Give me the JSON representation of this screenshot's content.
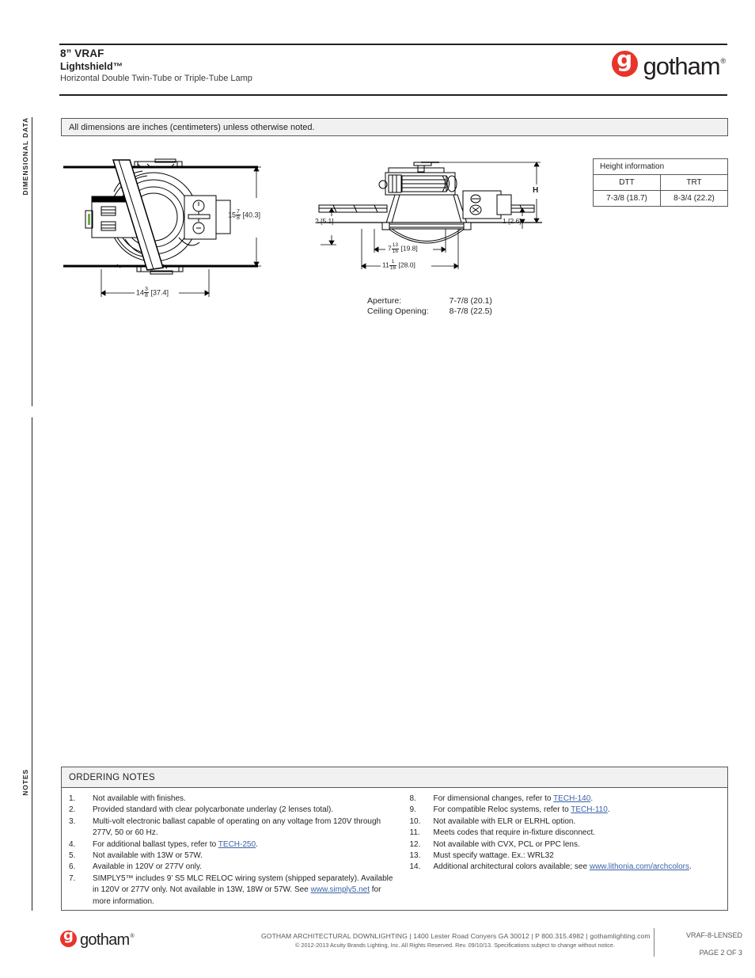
{
  "header": {
    "title": "8” VRAF",
    "subtitle": "Lightshield™",
    "description": "Horizontal Double Twin-Tube or Triple-Tube Lamp",
    "brand_word": "gotham",
    "brand_letter": "g",
    "brand_reg": "®",
    "brand_color": "#e8342a"
  },
  "side_tabs": {
    "dimensional": "DIMENSIONAL DATA",
    "notes": "NOTES"
  },
  "notice": {
    "text": "All dimensions are inches (centimeters) unless otherwise noted."
  },
  "height_table": {
    "caption": "Height information",
    "columns": [
      "DTT",
      "TRT"
    ],
    "values": [
      "7-3/8 (18.7)",
      "8-3/4 (22.2)"
    ]
  },
  "drawings": {
    "plan": {
      "name": "plan-view",
      "dim_width": {
        "whole": "14",
        "num": "3",
        "den": "8",
        "metric": "[37.4]"
      },
      "dim_height": {
        "whole": "15",
        "num": "7",
        "den": "8",
        "metric": "[40.3]"
      }
    },
    "section": {
      "name": "section-view",
      "dim_left": "2 [5.1]",
      "dim_right": "1 [2.6]",
      "dim_height_symbol": "H",
      "dim_inner": {
        "whole": "7",
        "num": "13",
        "den": "16",
        "metric": "[19.8]"
      },
      "dim_outer": {
        "whole": "11",
        "num": "1",
        "den": "16",
        "metric": "[28.0]"
      }
    }
  },
  "aperture": {
    "rows": [
      {
        "label": "Aperture:",
        "value": "7-7/8 (20.1)"
      },
      {
        "label": "Ceiling Opening:",
        "value": "8-7/8 (22.5)"
      }
    ]
  },
  "ordering_notes": {
    "title": "ORDERING NOTES",
    "link_color": "#3b63a8",
    "left": [
      {
        "num": "1.",
        "parts": [
          {
            "t": "Not available with finishes."
          }
        ]
      },
      {
        "num": "2.",
        "parts": [
          {
            "t": "Provided standard with clear polycarbonate underlay (2 lenses total)."
          }
        ]
      },
      {
        "num": "3.",
        "parts": [
          {
            "t": "Multi-volt electronic ballast capable of operating on any voltage from 120V through 277V, 50 or 60 Hz."
          }
        ]
      },
      {
        "num": "4.",
        "parts": [
          {
            "t": "For additional ballast types, refer to "
          },
          {
            "t": "TECH-250",
            "link": true
          },
          {
            "t": "."
          }
        ]
      },
      {
        "num": "5.",
        "parts": [
          {
            "t": "Not available with 13W or 57W."
          }
        ]
      },
      {
        "num": "6.",
        "parts": [
          {
            "t": "Available in 120V or 277V only."
          }
        ]
      },
      {
        "num": "7.",
        "parts": [
          {
            "t": "SIMPLY5™ includes 9’ S5 MLC RELOC wiring system (shipped separately). Available in 120V or 277V only. Not available in 13W, 18W or 57W. See "
          },
          {
            "t": "www.simply5.net",
            "link": true
          },
          {
            "t": " for more information."
          }
        ]
      }
    ],
    "right": [
      {
        "num": "8.",
        "parts": [
          {
            "t": "For dimensional changes, refer to "
          },
          {
            "t": "TECH-140",
            "link": true
          },
          {
            "t": "."
          }
        ]
      },
      {
        "num": "9.",
        "parts": [
          {
            "t": "For compatible Reloc systems, refer to "
          },
          {
            "t": "TECH-110",
            "link": true
          },
          {
            "t": "."
          }
        ]
      },
      {
        "num": "10.",
        "parts": [
          {
            "t": "Not available with ELR or ELRHL option."
          }
        ]
      },
      {
        "num": "11.",
        "parts": [
          {
            "t": "Meets codes that require in-fixture disconnect."
          }
        ]
      },
      {
        "num": "12.",
        "parts": [
          {
            "t": "Not available with CVX, PCL or PPC lens."
          }
        ]
      },
      {
        "num": "13.",
        "parts": [
          {
            "t": "Must specify wattage. Ex.: WRL32"
          }
        ]
      },
      {
        "num": "14.",
        "parts": [
          {
            "t": "Additional architectural colors available; see "
          },
          {
            "t": "www.lithonia.com/archcolors",
            "link": true
          },
          {
            "t": "."
          }
        ]
      }
    ]
  },
  "footer": {
    "line1": "GOTHAM ARCHITECTURAL DOWNLIGHTING  |  1400 Lester Road Conyers GA 30012  |  P 800.315.4982  |  gothamlighting.com",
    "line2": "© 2012-2013 Acuity Brands Lighting, Inc. All Rights Reserved. Rev. 09/10/13. Specifications subject to change without notice.",
    "doc_code": "VRAF-8-LENSED",
    "page": "PAGE 2 OF 3"
  }
}
